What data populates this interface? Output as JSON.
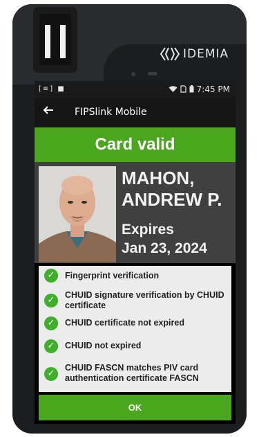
{
  "device": {
    "brand": "IDEMIA"
  },
  "status_bar": {
    "time": "7:45 PM"
  },
  "app_bar": {
    "title": "FIPSlink Mobile"
  },
  "banner": {
    "text": "Card valid",
    "color": "#4aa71d"
  },
  "card": {
    "name_line1": "MAHON,",
    "name_line2": "ANDREW P.",
    "expires_label": "Expires",
    "expires_date": "Jan 23, 2024"
  },
  "checks": [
    {
      "label": "Fingerprint verification",
      "status": "passed"
    },
    {
      "label": "CHUID signature verification by CHUID certificate",
      "status": "passed"
    },
    {
      "label": "CHUID certificate not expired",
      "status": "passed"
    },
    {
      "label": "CHUID not expired",
      "status": "passed"
    },
    {
      "label": "CHUID FASCN matches PIV card authentication certificate FASCN",
      "status": "passed"
    }
  ],
  "ok_button": {
    "label": "OK"
  },
  "colors": {
    "success": "#4aa71d",
    "check_icon": "#3fae2a",
    "panel": "#404040"
  }
}
